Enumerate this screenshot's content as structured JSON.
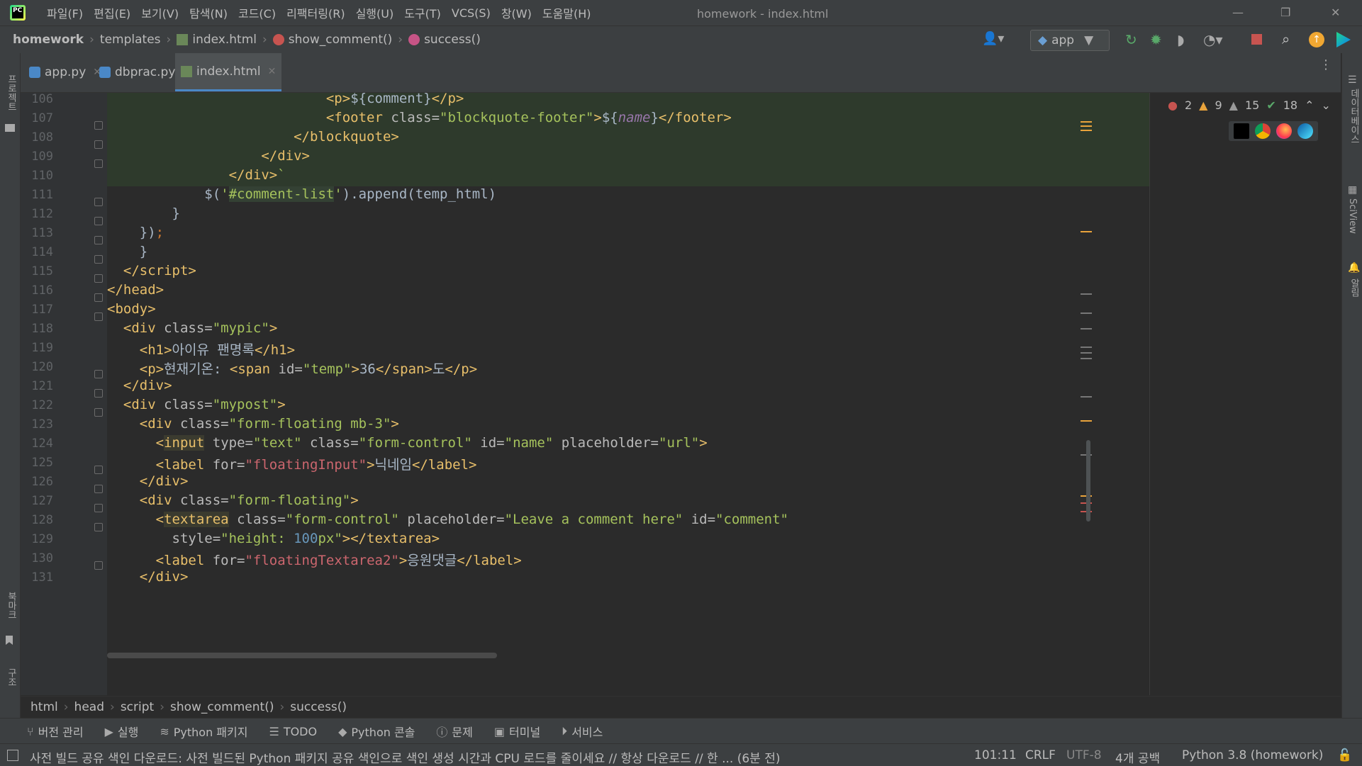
{
  "titlebar": {
    "menu": [
      "파일(F)",
      "편집(E)",
      "보기(V)",
      "탐색(N)",
      "코드(C)",
      "리팩터링(R)",
      "실행(U)",
      "도구(T)",
      "VCS(S)",
      "창(W)",
      "도움말(H)"
    ],
    "title": "homework - index.html"
  },
  "navbar": {
    "breadcrumb": [
      "homework",
      "templates",
      "index.html",
      "show_comment()",
      "success()"
    ],
    "run_config": "app"
  },
  "tabs": [
    {
      "label": "app.py",
      "active": false
    },
    {
      "label": "dbprac.py",
      "active": false
    },
    {
      "label": "index.html",
      "active": true
    }
  ],
  "left_strip": {
    "project": "프로젝트",
    "bookmarks": "북마크",
    "structure": "구조"
  },
  "right_strip": {
    "database": "데이터베이스",
    "sciview": "SciView",
    "notifications": "알림"
  },
  "inspections": {
    "errors": "2",
    "warnings": "9",
    "weak_warnings": "15",
    "ok": "18"
  },
  "editor": {
    "line_numbers": [
      "106",
      "107",
      "108",
      "109",
      "110",
      "111",
      "112",
      "113",
      "114",
      "115",
      "116",
      "117",
      "118",
      "119",
      "120",
      "121",
      "122",
      "123",
      "124",
      "125",
      "126",
      "127",
      "128",
      "129",
      "130",
      "131"
    ]
  },
  "bottom_breadcrumb": [
    "html",
    "head",
    "script",
    "show_comment()",
    "success()"
  ],
  "tool_windows": [
    "버전 관리",
    "실행",
    "Python 패키지",
    "TODO",
    "Python 콘솔",
    "문제",
    "터미널",
    "서비스"
  ],
  "status": {
    "message": "사전 빌드 공유 색인 다운로드: 사전 빌드된 Python 패키지 공유 색인으로 색인 생성 시간과 CPU 로드를 줄이세요 // 항상 다운로드 // 한 ... (6분 전)",
    "position": "101:11",
    "line_sep": "CRLF",
    "encoding": "UTF-8",
    "indent": "4개 공백",
    "interpreter": "Python 3.8 (homework)"
  },
  "colors": {
    "accent": "#4a88c7",
    "bg": "#2b2b2b",
    "panel": "#3c3f41",
    "tag": "#e8bf6a",
    "string": "#a5c25c"
  }
}
